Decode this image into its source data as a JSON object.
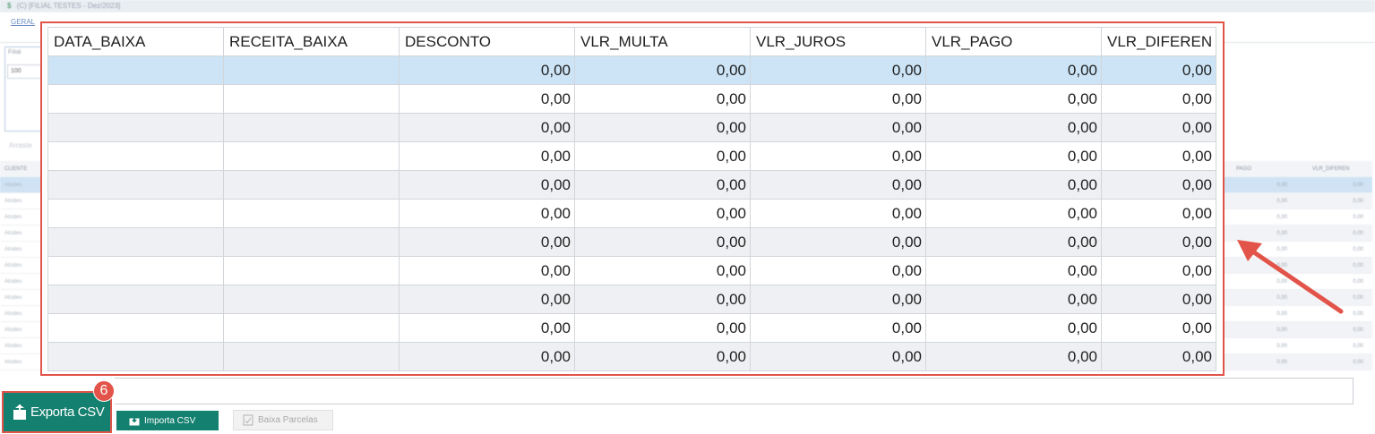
{
  "window": {
    "title": "(C) [FILIAL TESTES - Dez/2023]"
  },
  "background": {
    "tab_label": "GERAL",
    "filial_label": "Filial",
    "filial_value": "100",
    "drag_hint": "Arraste",
    "left_col_header": "CLIENTE",
    "left_col_value": "Alcides",
    "right_headers": [
      "PAGO",
      "VLR_DIFEREN"
    ],
    "right_value": "0,00"
  },
  "grid": {
    "columns": [
      "DATA_BAIXA",
      "RECEITA_BAIXA",
      "DESCONTO",
      "VLR_MULTA",
      "VLR_JUROS",
      "VLR_PAGO",
      "VLR_DIFEREN"
    ],
    "rows": [
      [
        "",
        "",
        "0,00",
        "0,00",
        "0,00",
        "0,00",
        "0,00"
      ],
      [
        "",
        "",
        "0,00",
        "0,00",
        "0,00",
        "0,00",
        "0,00"
      ],
      [
        "",
        "",
        "0,00",
        "0,00",
        "0,00",
        "0,00",
        "0,00"
      ],
      [
        "",
        "",
        "0,00",
        "0,00",
        "0,00",
        "0,00",
        "0,00"
      ],
      [
        "",
        "",
        "0,00",
        "0,00",
        "0,00",
        "0,00",
        "0,00"
      ],
      [
        "",
        "",
        "0,00",
        "0,00",
        "0,00",
        "0,00",
        "0,00"
      ],
      [
        "",
        "",
        "0,00",
        "0,00",
        "0,00",
        "0,00",
        "0,00"
      ],
      [
        "",
        "",
        "0,00",
        "0,00",
        "0,00",
        "0,00",
        "0,00"
      ],
      [
        "",
        "",
        "0,00",
        "0,00",
        "0,00",
        "0,00",
        "0,00"
      ],
      [
        "",
        "",
        "0,00",
        "0,00",
        "0,00",
        "0,00",
        "0,00"
      ],
      [
        "",
        "",
        "0,00",
        "0,00",
        "0,00",
        "0,00",
        "0,00"
      ]
    ],
    "selected_row": 0
  },
  "toolbar": {
    "export_label": "Exporta CSV",
    "import_label": "Importa CSV",
    "baixa_label": "Baixa Parcelas",
    "step_badge": "6"
  },
  "colors": {
    "highlight": "#e25449",
    "button_teal": "#14806f",
    "selected_row": "#cce4f6"
  }
}
